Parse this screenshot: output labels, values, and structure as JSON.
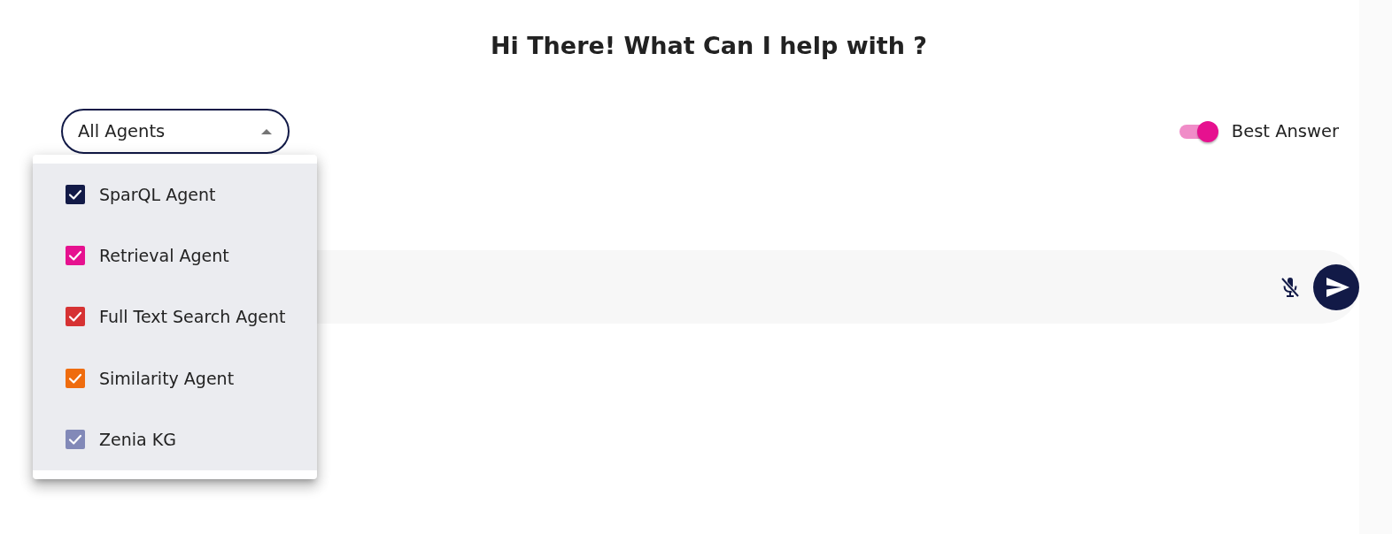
{
  "title": "Hi There! What Can I help with ?",
  "agent_select": {
    "value": "All Agents",
    "expanded": true
  },
  "agent_menu": {
    "items": [
      {
        "label": "SparQL Agent",
        "checked": true,
        "color": "#121a47"
      },
      {
        "label": "Retrieval Agent",
        "checked": true,
        "color": "#e6118f"
      },
      {
        "label": "Full Text Search Agent",
        "checked": true,
        "color": "#d63233"
      },
      {
        "label": "Similarity Agent",
        "checked": true,
        "color": "#ef6c0e"
      },
      {
        "label": "Zenia KG",
        "checked": true,
        "color": "#8289b8"
      }
    ]
  },
  "best_answer": {
    "label": "Best Answer",
    "on": true
  }
}
